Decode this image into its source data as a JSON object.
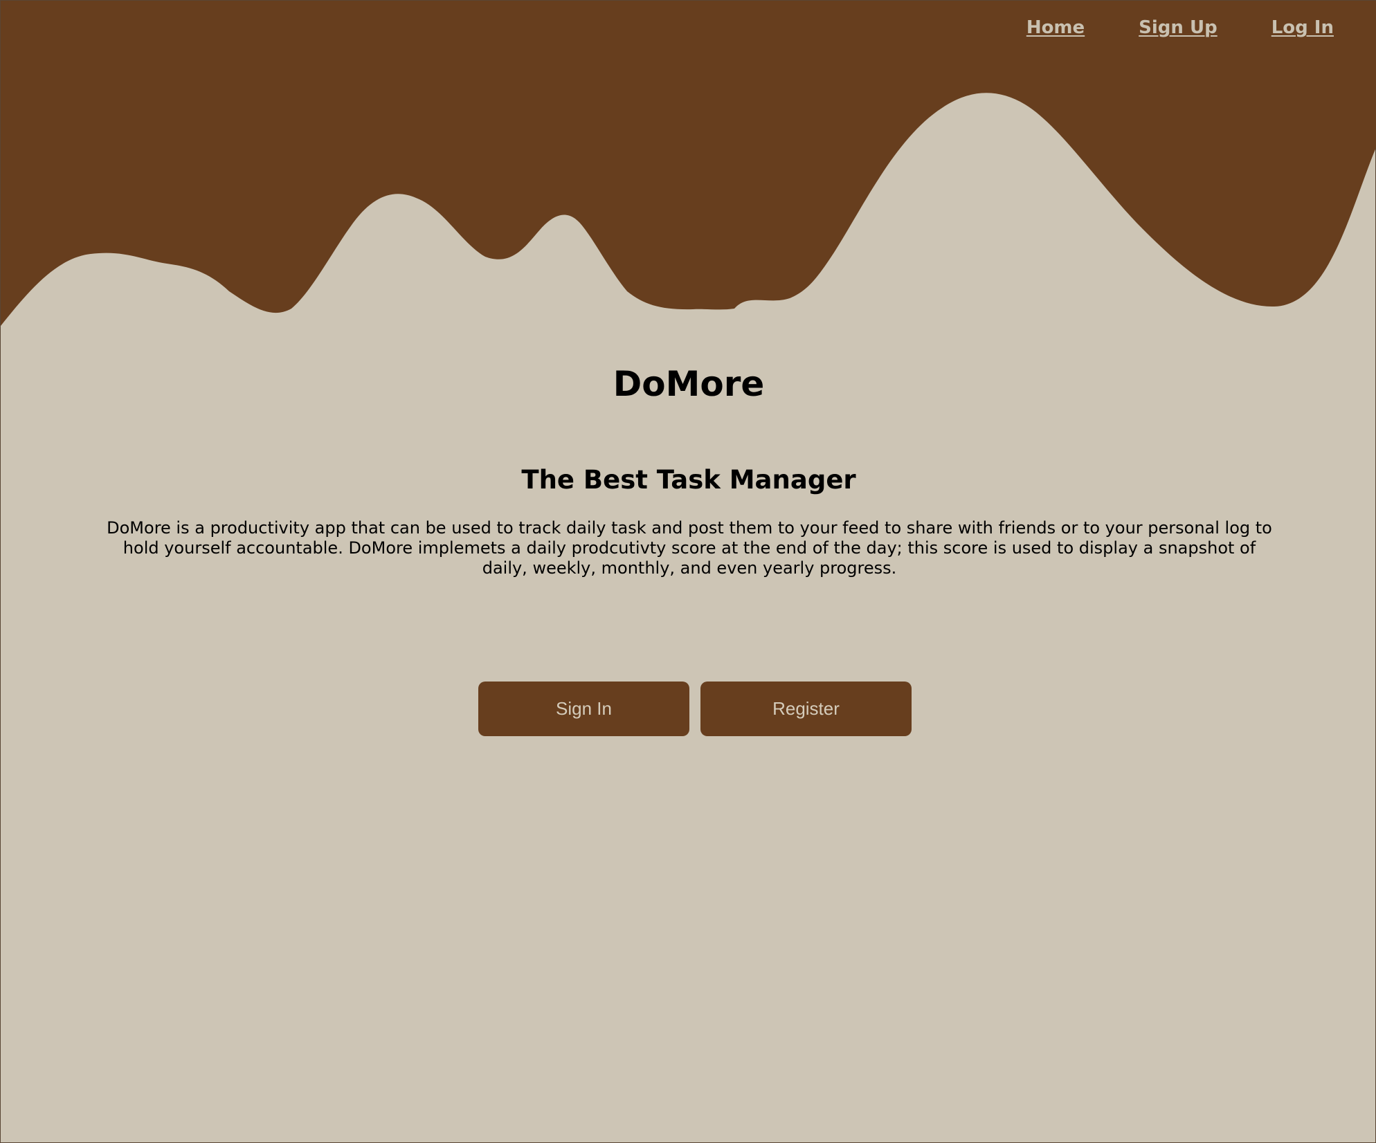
{
  "nav": {
    "links": [
      "Home",
      "Sign Up",
      "Log In"
    ]
  },
  "hero": {
    "title": "DoMore",
    "subtitle": "The Best Task Manager",
    "description": "DoMore is a productivity app that can be used to track daily task and post them to your feed to share with friends or to your personal log to hold yourself accountable. DoMore implemets a daily prodcutivty score at the end of the day; this score is used to display a snapshot of daily, weekly, monthly, and even yearly progress."
  },
  "actions": {
    "sign_in_label": "Sign In",
    "register_label": "Register"
  },
  "colors": {
    "brand_brown": "#673e1e",
    "background": "#cdc5b5",
    "nav_text": "#c9c1b1",
    "button_text": "#d5ccbb"
  }
}
